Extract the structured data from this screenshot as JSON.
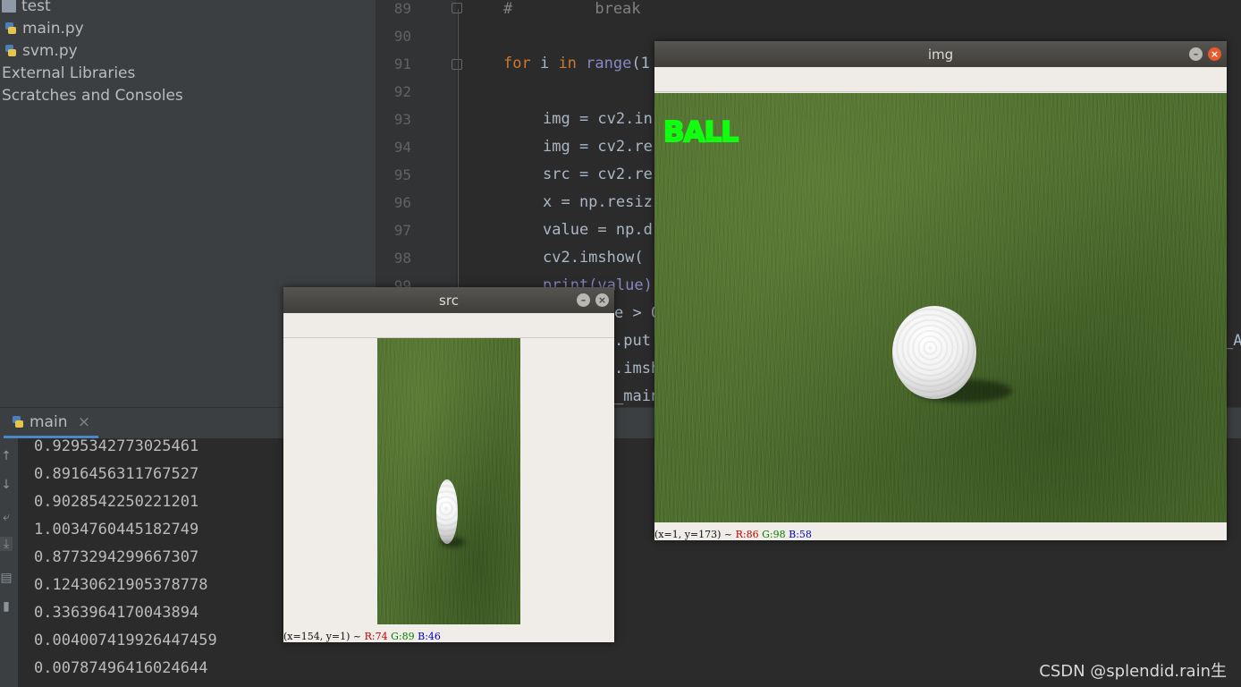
{
  "project_tree": {
    "items": [
      {
        "label": "test",
        "icon": "folder-icon"
      },
      {
        "label": "main.py",
        "icon": "python-file-icon"
      },
      {
        "label": "svm.py",
        "icon": "python-file-icon"
      },
      {
        "label": "External Libraries",
        "icon": ""
      },
      {
        "label": "Scratches and Consoles",
        "icon": ""
      }
    ]
  },
  "editor": {
    "line_numbers": [
      "89",
      "90",
      "91",
      "92",
      "93",
      "94",
      "95",
      "96",
      "97",
      "98",
      "99"
    ],
    "lines": {
      "l89_comment": "#         break",
      "l91_kw": "for",
      "l91_var": " i ",
      "l91_in": "in",
      "l91_rest_bi": " range",
      "l91_rest": "(1",
      "l93": "img = cv2.in",
      "l94": "img = cv2.re",
      "l95": "src = cv2.re",
      "l96": "x = np.resiz",
      "l97": "value = np.d",
      "l98": "cv2.imshow(",
      "l99": "print(value)",
      "l100": "e > 0",
      "l101": ".put",
      "l102": ".imsh",
      "l103": "_main_",
      "l101_tail": "_A"
    }
  },
  "run_panel": {
    "tab_label": "main",
    "close_glyph": "×",
    "output": [
      "0.9295342773025461",
      "0.8916456311767527",
      "0.9028542250221201",
      "1.0034760445182749",
      "0.8773294299667307",
      "0.12430621905378778",
      "0.3363964170043894",
      "0.004007419926447459",
      "0.00787496416024644"
    ],
    "toolbar_icons": [
      "up-arrow-icon",
      "down-arrow-icon",
      "soft-wrap-icon",
      "scroll-to-end-icon",
      "print-icon",
      "trash-icon"
    ]
  },
  "src_window": {
    "title": "src",
    "status": {
      "coords": "(x=154, y=1) ~ ",
      "r": "R:74",
      "g": "G:89",
      "b": "B:46"
    }
  },
  "img_window": {
    "title": "img",
    "overlay_label": "BALL",
    "status": {
      "coords": "(x=1, y=173) ~ ",
      "r": "R:86",
      "g": "G:98",
      "b": "B:58"
    }
  },
  "watermark": "CSDN @splendid.rain生",
  "colors": {
    "ide_bg": "#2b2b2b",
    "panel_bg": "#3c3f41",
    "keyword": "#cc7832",
    "builtin": "#8888c6",
    "ball_label": "#10ff10"
  }
}
